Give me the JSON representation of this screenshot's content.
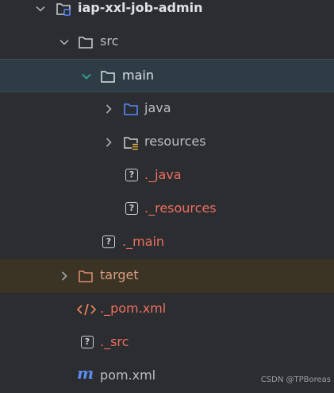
{
  "project_tree": {
    "root": {
      "label": "iap-xxl-job-admin",
      "icon": "module-folder-icon",
      "expanded": true
    },
    "src": {
      "label": "src",
      "icon": "folder-icon",
      "expanded": true
    },
    "main": {
      "label": "main",
      "icon": "folder-icon",
      "expanded": true,
      "selected": true
    },
    "java": {
      "label": "java",
      "icon": "source-folder-icon",
      "expanded": false
    },
    "resources": {
      "label": "resources",
      "icon": "resources-folder-icon",
      "expanded": false
    },
    "file_java": {
      "label": "._java",
      "icon": "unknown-file-icon"
    },
    "file_resources": {
      "label": "._resources",
      "icon": "unknown-file-icon"
    },
    "file_main": {
      "label": "._main",
      "icon": "unknown-file-icon"
    },
    "target": {
      "label": "target",
      "icon": "excluded-folder-icon",
      "expanded": false
    },
    "file_pom_xml": {
      "label": "._pom.xml",
      "icon": "xml-file-icon"
    },
    "file_src": {
      "label": "._src",
      "icon": "unknown-file-icon"
    },
    "pom": {
      "label": "pom.xml",
      "icon": "maven-icon"
    }
  },
  "colors": {
    "background": "#2b2d30",
    "selected_row": "#2e3c46",
    "excluded_row": "#3b3424",
    "unversioned_text": "#ef6f5f",
    "excluded_text": "#d99e82",
    "source_folder": "#548af7",
    "maven_icon": "#5b8def"
  },
  "watermark": "CSDN @TPBoreas"
}
